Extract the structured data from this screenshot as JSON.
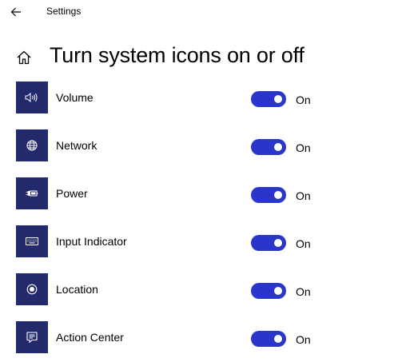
{
  "app": {
    "title": "Settings"
  },
  "header": {
    "title": "Turn system icons on or off"
  },
  "items": [
    {
      "label": "Volume",
      "icon": "volume-icon",
      "state": "On",
      "on": true
    },
    {
      "label": "Network",
      "icon": "globe-icon",
      "state": "On",
      "on": true
    },
    {
      "label": "Power",
      "icon": "battery-plug-icon",
      "state": "On",
      "on": true
    },
    {
      "label": "Input Indicator",
      "icon": "keyboard-icon",
      "state": "On",
      "on": true
    },
    {
      "label": "Location",
      "icon": "location-target-icon",
      "state": "On",
      "on": true
    },
    {
      "label": "Action Center",
      "icon": "chat-message-icon",
      "state": "On",
      "on": true
    }
  ],
  "colors": {
    "tile": "#232a6b",
    "toggle_on": "#2a35c9"
  }
}
